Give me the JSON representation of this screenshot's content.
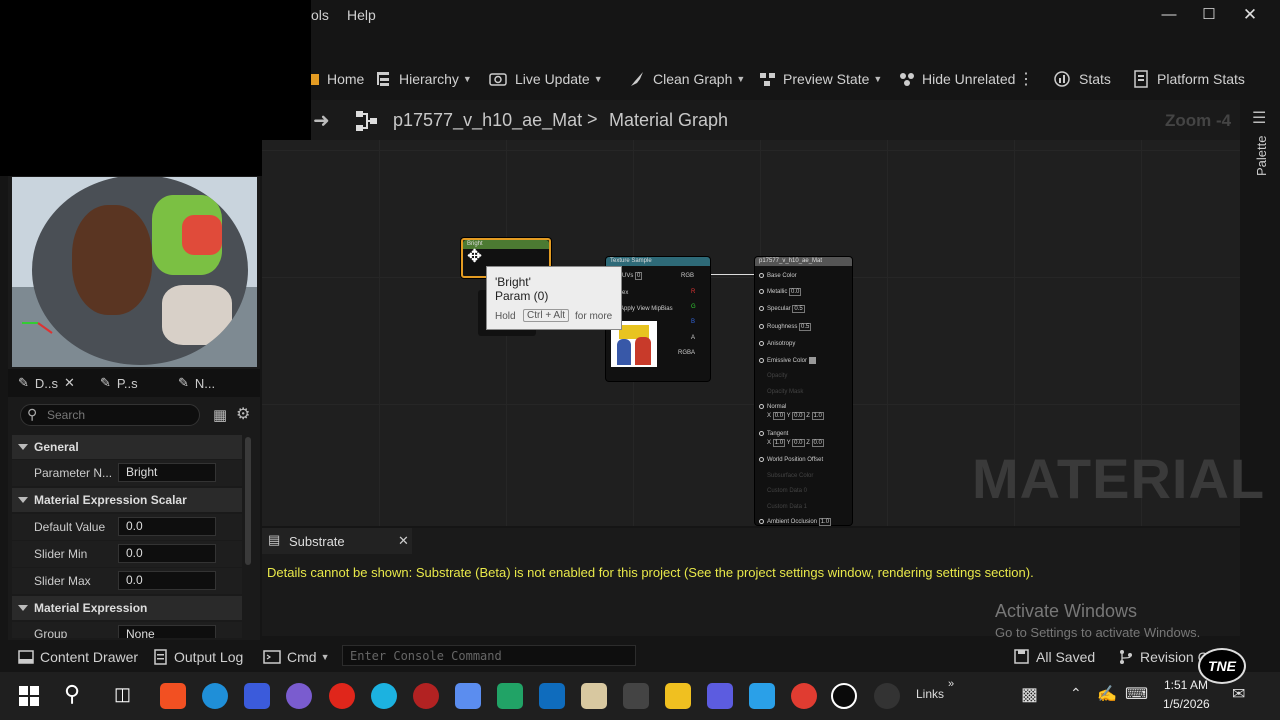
{
  "window": {
    "menu": [
      "ols",
      "Help"
    ]
  },
  "toolbar": {
    "home": "Home",
    "hierarchy": "Hierarchy",
    "live_update": "Live Update",
    "clean_graph": "Clean Graph",
    "preview_state": "Preview State",
    "hide_unrelated": "Hide Unrelated",
    "stats": "Stats",
    "platform_stats": "Platform Stats"
  },
  "breadcrumb": {
    "asset": "p17577_v_h10_ae_Mat",
    "separator": ">",
    "graph": "Material Graph",
    "zoom": "Zoom -4"
  },
  "palette_label": "Palette",
  "graph": {
    "watermark": "MATERIAL",
    "param_node": {
      "title": "Bright"
    },
    "texture_node": {
      "title": "Texture Sample",
      "pins_left": [
        "UVs",
        "ex",
        "Apply View MipBias"
      ],
      "uvs_value": "0",
      "pins_right": [
        "RGB",
        "R",
        "G",
        "B",
        "A",
        "RGBA"
      ]
    },
    "material_node": {
      "title": "p17577_v_h10_ae_Mat",
      "pins": [
        {
          "label": "Base Color",
          "value": ""
        },
        {
          "label": "Metallic",
          "value": "0.0"
        },
        {
          "label": "Specular",
          "value": "0.5"
        },
        {
          "label": "Roughness",
          "value": "0.5"
        },
        {
          "label": "Anisotropy",
          "value": ""
        },
        {
          "label": "Emissive Color",
          "value": ""
        },
        {
          "label": "Opacity",
          "value": ""
        },
        {
          "label": "Opacity Mask",
          "value": ""
        },
        {
          "label": "Normal",
          "value": ""
        },
        {
          "label": "Tangent",
          "value": ""
        },
        {
          "label": "World Position Offset",
          "value": ""
        },
        {
          "label": "Subsurface Color",
          "value": ""
        },
        {
          "label": "Custom Data 0",
          "value": ""
        },
        {
          "label": "Custom Data 1",
          "value": ""
        },
        {
          "label": "Ambient Occlusion",
          "value": "1.0"
        }
      ],
      "normal_vals": [
        "0.0",
        "0.0",
        "1.0"
      ],
      "tangent_vals": [
        "1.0",
        "0.0",
        "0.0"
      ],
      "axis_letters": [
        "X",
        "Y",
        "Z"
      ]
    },
    "tooltip": {
      "line1": "'Bright'",
      "line2": "Param (0)",
      "hold": "Hold",
      "keys": "Ctrl + Alt",
      "more": "for more"
    }
  },
  "details": {
    "tabs": [
      "D..s",
      "P..s",
      "N..."
    ],
    "search_placeholder": "Search",
    "sections": {
      "general": "General",
      "scalar": "Material Expression Scalar Parameter",
      "expression": "Material Expression"
    },
    "rows": {
      "param_name_label": "Parameter N...",
      "param_name_value": "Bright",
      "default_label": "Default Value",
      "default_value": "0.0",
      "slider_min_label": "Slider Min",
      "slider_min_value": "0.0",
      "slider_max_label": "Slider Max",
      "slider_max_value": "0.0",
      "group_label": "Group",
      "group_value": "None"
    }
  },
  "substrate": {
    "title": "Substrate",
    "message": "Details cannot be shown: Substrate (Beta) is not enabled for this project (See the project settings window, rendering settings section).",
    "activate_title": "Activate Windows",
    "activate_sub": "Go to Settings to activate Windows."
  },
  "statusbar": {
    "content_drawer": "Content Drawer",
    "output_log": "Output Log",
    "cmd": "Cmd",
    "console_placeholder": "Enter Console Command",
    "all_saved": "All Saved",
    "revision": "Revision C"
  },
  "taskbar": {
    "links": "Links",
    "time": "1:51 AM",
    "date": "1/5/2026",
    "badge": "TNE"
  },
  "colors": {
    "accent_orange": "#e39b22",
    "param_node_green": "#4c7a32",
    "texture_node_teal": "#2e6a78",
    "material_node_gray": "#555555",
    "message_yellow": "#e8e84a"
  }
}
